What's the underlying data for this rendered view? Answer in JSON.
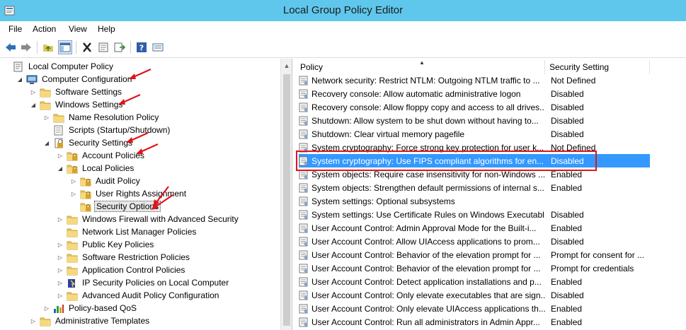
{
  "window": {
    "title": "Local Group Policy Editor"
  },
  "menu": [
    "File",
    "Action",
    "View",
    "Help"
  ],
  "toolbar": {
    "icons": [
      "back-icon",
      "forward-icon",
      "up-folder-icon",
      "show-tree-icon",
      "delete-icon",
      "properties-icon",
      "export-list-icon",
      "help-icon",
      "filter-icon"
    ]
  },
  "tree": [
    {
      "label": "Local Computer Policy",
      "level": 0,
      "expander": "",
      "icon": "policy"
    },
    {
      "label": "Computer Configuration",
      "level": 1,
      "expander": "open",
      "icon": "computer"
    },
    {
      "label": "Software Settings",
      "level": 2,
      "expander": "closed",
      "icon": "folder"
    },
    {
      "label": "Windows Settings",
      "level": 2,
      "expander": "open",
      "icon": "folder"
    },
    {
      "label": "Name Resolution Policy",
      "level": 3,
      "expander": "closed",
      "icon": "folder"
    },
    {
      "label": "Scripts (Startup/Shutdown)",
      "level": 3,
      "expander": "",
      "icon": "script"
    },
    {
      "label": "Security Settings",
      "level": 3,
      "expander": "open",
      "icon": "secure"
    },
    {
      "label": "Account Policies",
      "level": 4,
      "expander": "closed",
      "icon": "lockfolder"
    },
    {
      "label": "Local Policies",
      "level": 4,
      "expander": "open",
      "icon": "lockfolder"
    },
    {
      "label": "Audit Policy",
      "level": 5,
      "expander": "closed",
      "icon": "lockfolder"
    },
    {
      "label": "User Rights Assignment",
      "level": 5,
      "expander": "closed",
      "icon": "lockfolder"
    },
    {
      "label": "Security Options",
      "level": 5,
      "expander": "",
      "icon": "lockfolder",
      "selected": true
    },
    {
      "label": "Windows Firewall with Advanced Security",
      "level": 4,
      "expander": "closed",
      "icon": "folder"
    },
    {
      "label": "Network List Manager Policies",
      "level": 4,
      "expander": "",
      "icon": "folder"
    },
    {
      "label": "Public Key Policies",
      "level": 4,
      "expander": "closed",
      "icon": "folder"
    },
    {
      "label": "Software Restriction Policies",
      "level": 4,
      "expander": "closed",
      "icon": "folder"
    },
    {
      "label": "Application Control Policies",
      "level": 4,
      "expander": "closed",
      "icon": "folder"
    },
    {
      "label": "IP Security Policies on Local Computer",
      "level": 4,
      "expander": "closed",
      "icon": "ipsec"
    },
    {
      "label": "Advanced Audit Policy Configuration",
      "level": 4,
      "expander": "closed",
      "icon": "folder"
    },
    {
      "label": "Policy-based QoS",
      "level": 3,
      "expander": "closed",
      "icon": "chart"
    },
    {
      "label": "Administrative Templates",
      "level": 2,
      "expander": "closed",
      "icon": "folder"
    }
  ],
  "list": {
    "columns": [
      "Policy",
      "Security Setting"
    ],
    "rows": [
      {
        "policy": "Network security: Restrict NTLM: Outgoing NTLM traffic to ...",
        "setting": "Not Defined"
      },
      {
        "policy": "Recovery console: Allow automatic administrative logon",
        "setting": "Disabled"
      },
      {
        "policy": "Recovery console: Allow floppy copy and access to all drives...",
        "setting": "Disabled"
      },
      {
        "policy": "Shutdown: Allow system to be shut down without having to...",
        "setting": "Disabled"
      },
      {
        "policy": "Shutdown: Clear virtual memory pagefile",
        "setting": "Disabled"
      },
      {
        "policy": "System cryptography: Force strong key protection for user k...",
        "setting": "Not Defined"
      },
      {
        "policy": "System cryptography: Use FIPS compliant algorithms for en...",
        "setting": "Disabled",
        "selected": true
      },
      {
        "policy": "System objects: Require case insensitivity for non-Windows ...",
        "setting": "Enabled"
      },
      {
        "policy": "System objects: Strengthen default permissions of internal s...",
        "setting": "Enabled"
      },
      {
        "policy": "System settings: Optional subsystems",
        "setting": ""
      },
      {
        "policy": "System settings: Use Certificate Rules on Windows Executabl...",
        "setting": "Disabled"
      },
      {
        "policy": "User Account Control: Admin Approval Mode for the Built-i...",
        "setting": "Enabled"
      },
      {
        "policy": "User Account Control: Allow UIAccess applications to prom...",
        "setting": "Disabled"
      },
      {
        "policy": "User Account Control: Behavior of the elevation prompt for ...",
        "setting": "Prompt for consent for ..."
      },
      {
        "policy": "User Account Control: Behavior of the elevation prompt for ...",
        "setting": "Prompt for credentials"
      },
      {
        "policy": "User Account Control: Detect application installations and p...",
        "setting": "Enabled"
      },
      {
        "policy": "User Account Control: Only elevate executables that are sign...",
        "setting": "Disabled"
      },
      {
        "policy": "User Account Control: Only elevate UIAccess applications th...",
        "setting": "Enabled"
      },
      {
        "policy": "User Account Control: Run all administrators in Admin Appr...",
        "setting": "Enabled"
      }
    ]
  },
  "annotations": {
    "color": "#e0141b",
    "arrow_count": 6
  }
}
